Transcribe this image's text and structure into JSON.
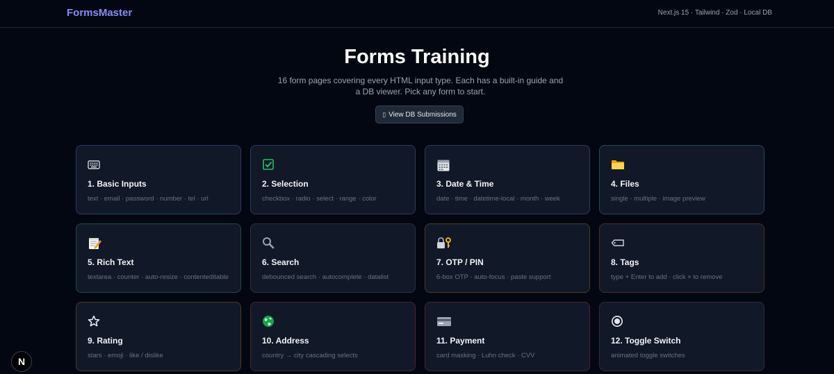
{
  "header": {
    "brand": "FormsMaster",
    "stack": "Next.js 15 · Tailwind · Zod · Local DB"
  },
  "hero": {
    "title": "Forms Training",
    "subtitle": "16 form pages covering every HTML input type. Each has a built-in guide and a DB viewer. Pick any form to start.",
    "db_button": "View DB Submissions",
    "db_button_icon": "database-icon"
  },
  "cards": [
    {
      "title": "1. Basic Inputs",
      "desc": "text · email · password · number · tel · url",
      "icon": "keyboard-icon",
      "border": "#2b3a66"
    },
    {
      "title": "2. Selection",
      "desc": "checkbox · radio · select · range · color",
      "icon": "checkbox-icon",
      "border": "#2f3a5e"
    },
    {
      "title": "3. Date & Time",
      "desc": "date · time · datetime-local · month · week",
      "icon": "calendar-icon",
      "border": "#2f3a5e"
    },
    {
      "title": "4. Files",
      "desc": "single · multiple · image preview",
      "icon": "folder-icon",
      "border": "#1f4a56"
    },
    {
      "title": "5. Rich Text",
      "desc": "textarea · counter · auto-resize · contenteditable",
      "icon": "memo-icon",
      "border": "#1f4a46"
    },
    {
      "title": "6. Search",
      "desc": "debounced search · autocomplete · datalist",
      "icon": "search-icon",
      "border": "#2a3340"
    },
    {
      "title": "7. OTP / PIN",
      "desc": "6-box OTP · auto-focus · paste support",
      "icon": "lock-key-icon",
      "border": "#4a3f24"
    },
    {
      "title": "8. Tags",
      "desc": "type + Enter to add · click × to remove",
      "icon": "tag-icon",
      "border": "#4a3024"
    },
    {
      "title": "9. Rating",
      "desc": "stars · emoji · like / dislike",
      "icon": "star-icon",
      "border": "#4a3a22"
    },
    {
      "title": "10. Address",
      "desc": "country → city cascading selects",
      "icon": "globe-icon",
      "border": "#4a2530"
    },
    {
      "title": "11. Payment",
      "desc": "card masking · Luhn check · CVV",
      "icon": "credit-card-icon",
      "border": "#4a2436"
    },
    {
      "title": "12. Toggle Switch",
      "desc": "animated toggle switches",
      "icon": "radio-button-icon",
      "border": "#3a2540"
    }
  ],
  "colors": {
    "accent": "#818cf8",
    "background": "#030712",
    "card": "#111827"
  },
  "next_badge": "N"
}
